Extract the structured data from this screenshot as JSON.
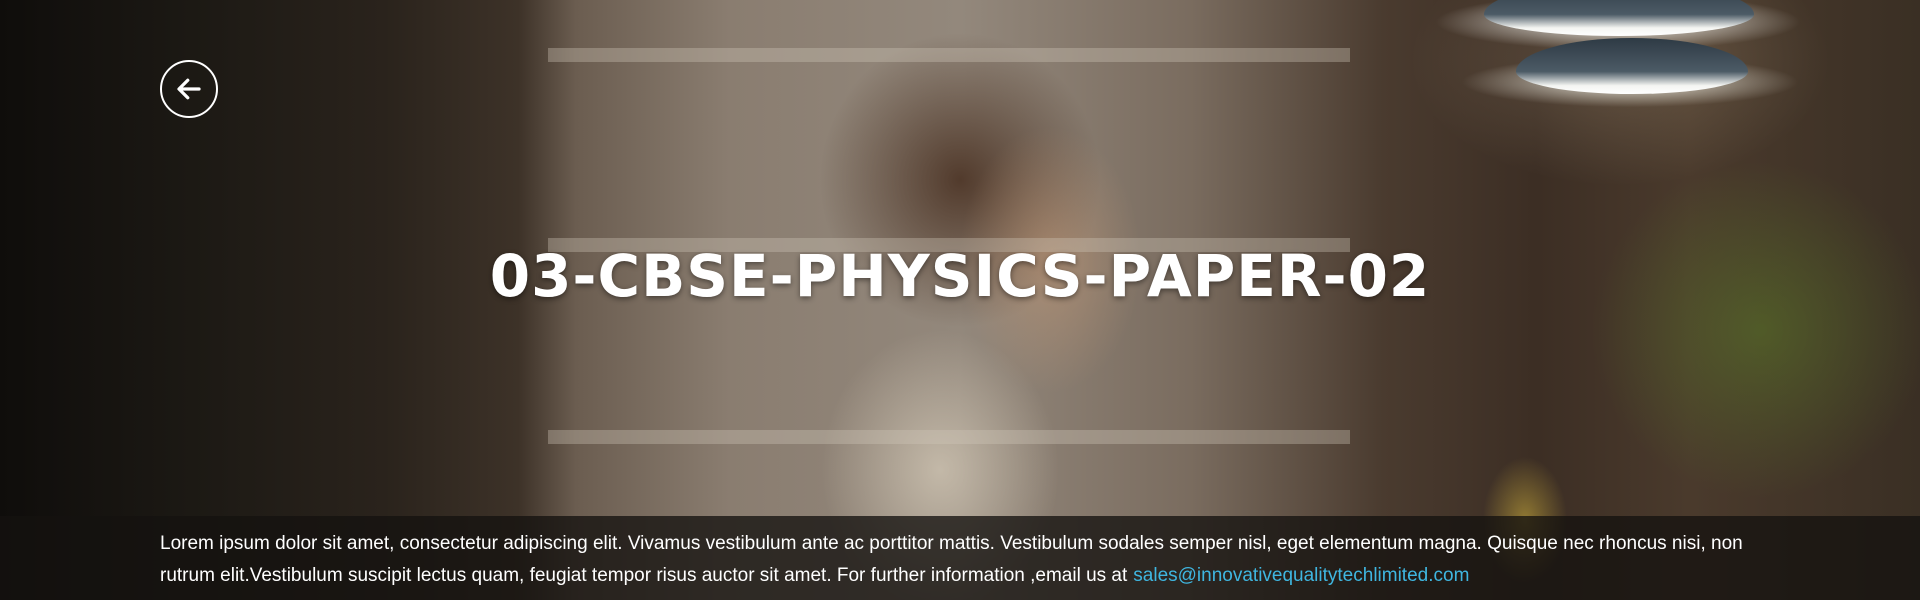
{
  "page": {
    "title": "03-CBSE-PHYSICS-PAPER-02"
  },
  "footer": {
    "description": "Lorem ipsum dolor sit amet, consectetur adipiscing elit. Vivamus vestibulum ante ac porttitor mattis. Vestibulum sodales semper nisl, eget elementum magna. Quisque nec rhoncus nisi, non rutrum elit.Vestibulum suscipit lectus quam, feugiat tempor risus auctor sit amet. For further information ,email us at",
    "email": "sales@innovativequalitytechlimited.com"
  },
  "icons": {
    "back": "arrow-left-icon"
  },
  "colors": {
    "title_text": "#ffffff",
    "email_link": "#3fb6e0",
    "footer_overlay": "#141210"
  }
}
